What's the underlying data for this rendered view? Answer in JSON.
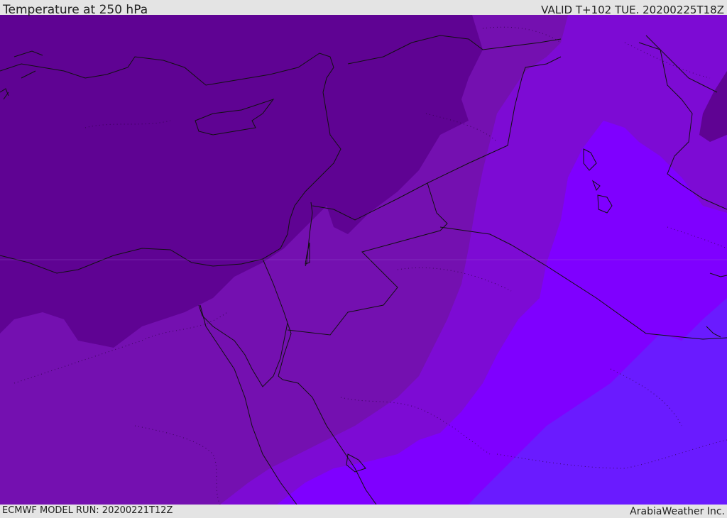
{
  "header": {
    "title": "Temperature at 250 hPa",
    "valid_time": "VALID T+102 TUE. 20200225T18Z"
  },
  "footer": {
    "model_run": "ECMWF MODEL RUN: 20200221T12Z",
    "credit": "ArabiaWeather Inc."
  },
  "map": {
    "field": "temperature",
    "level": "250 hPa",
    "colors": {
      "coldest": "#5f0393",
      "cold": "#7410b0",
      "mid": "#7d0bd4",
      "warm": "#7f00ff",
      "warmest": "#6a1bff",
      "coast_line": "#111111"
    }
  }
}
